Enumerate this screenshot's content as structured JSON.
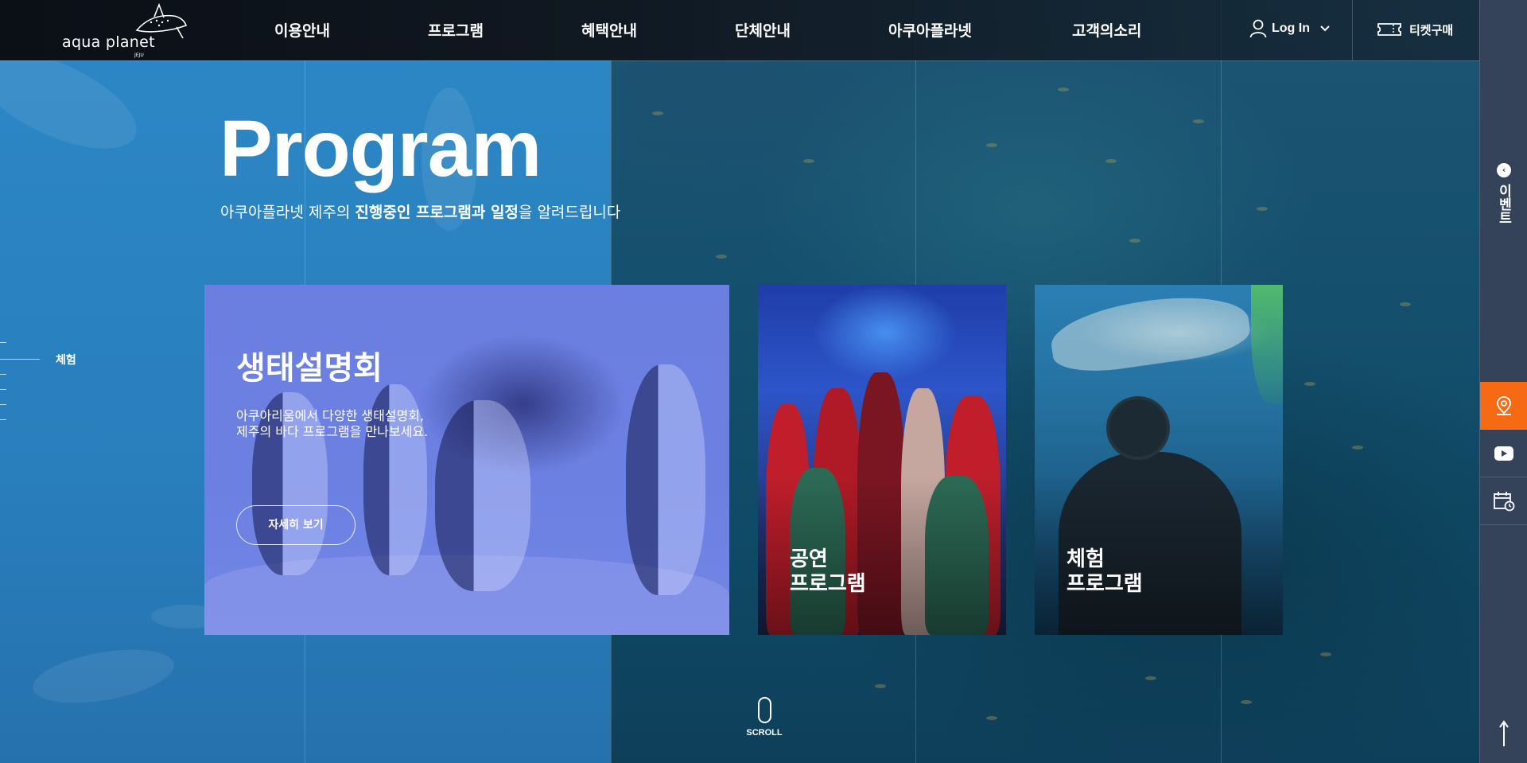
{
  "header": {
    "logo_text": "aqua planet",
    "logo_sub": "JEJU",
    "nav": [
      "이용안내",
      "프로그램",
      "혜택안내",
      "단체안내",
      "아쿠아플라넷",
      "고객의소리"
    ],
    "login_label": "Log In",
    "ticket_label": "티켓구매"
  },
  "hero": {
    "title": "Program",
    "sub_prefix": "아쿠아플라넷 제주의 ",
    "sub_bold": "진행중인 프로그램과 일정",
    "sub_suffix": "을 알려드립니다"
  },
  "indicator": {
    "active_label": "체험"
  },
  "cards": {
    "feature": {
      "title": "생태설명회",
      "desc_line1": "아쿠아리움에서 다양한 생태설명회,",
      "desc_line2": "제주의 바다 프로그램을 만나보세요.",
      "button": "자세히 보기"
    },
    "show": {
      "title": "공연\n프로그램"
    },
    "dive": {
      "title": "체험\n프로그램"
    }
  },
  "sidebar": {
    "event_label": "이벤트",
    "event_icon": "chevron-left-icon",
    "buttons": [
      "location-pin-icon",
      "youtube-icon",
      "calendar-clock-icon"
    ],
    "top_icon": "arrow-up-icon"
  },
  "scroll_label": "SCROLL",
  "colors": {
    "accent": "#f56a13",
    "sidebar": "#35435a",
    "panel_blue": "#2e8ccd",
    "feature_card": "#6b7fe0"
  }
}
